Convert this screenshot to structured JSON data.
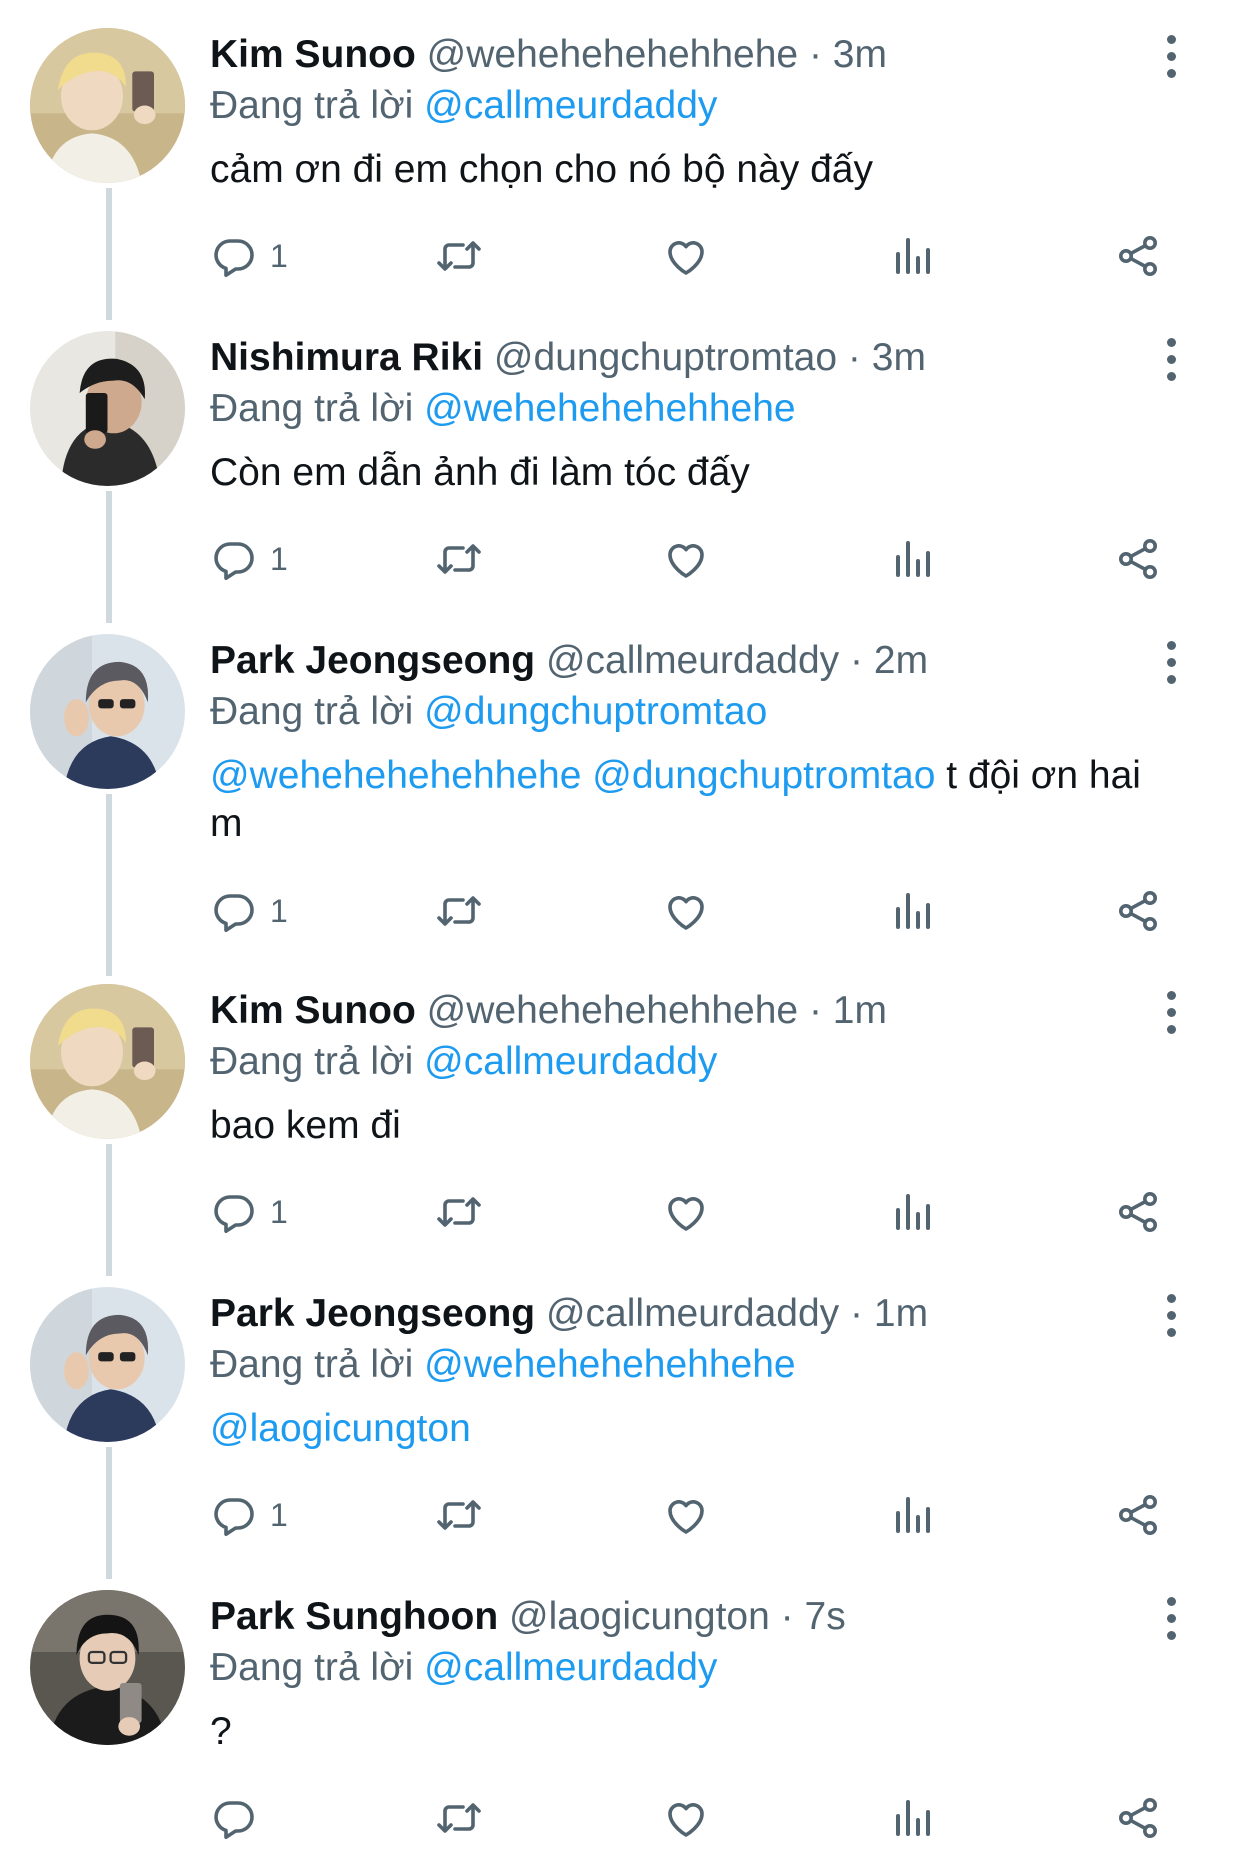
{
  "replying_prefix": "Đang trả lời",
  "tweets": [
    {
      "name": "Kim Sunoo",
      "handle": "@wehehehehehhehe",
      "separator": "·",
      "time": "3m",
      "replying_to": "@callmeurdaddy",
      "text": "cảm ơn đi em chọn cho nó bộ này đấy",
      "reply_count": "1",
      "avatar": "kim-sunoo-avatar"
    },
    {
      "name": "Nishimura Riki",
      "handle": "@dungchuptromtao",
      "separator": "·",
      "time": "3m",
      "replying_to": "@wehehehehehhehe",
      "text": "Còn em dẫn ảnh đi làm tóc đấy",
      "reply_count": "1",
      "avatar": "nishimura-riki-avatar"
    },
    {
      "name": "Park Jeongseong",
      "handle": "@callmeurdaddy",
      "separator": "·",
      "time": "2m",
      "replying_to": "@dungchuptromtao",
      "text_mention_1": "@wehehehehehhehe",
      "text_mention_2": "@dungchuptromtao",
      "text_tail": " t đội ơn hai m",
      "reply_count": "1",
      "avatar": "park-jeongseong-avatar"
    },
    {
      "name": "Kim Sunoo",
      "handle": "@wehehehehehhehe",
      "separator": "·",
      "time": "1m",
      "replying_to": "@callmeurdaddy",
      "text": "bao kem đi",
      "reply_count": "1",
      "avatar": "kim-sunoo-avatar"
    },
    {
      "name": "Park Jeongseong",
      "handle": "@callmeurdaddy",
      "separator": "·",
      "time": "1m",
      "replying_to": "@wehehehehehhehe",
      "text_mention_1": "@laogicungton",
      "reply_count": "1",
      "avatar": "park-jeongseong-avatar"
    },
    {
      "name": "Park Sunghoon",
      "handle": "@laogicungton",
      "separator": "·",
      "time": "7s",
      "replying_to": "@callmeurdaddy",
      "text": "?",
      "reply_count": "",
      "avatar": "park-sunghoon-avatar"
    }
  ],
  "colors": {
    "accent": "#1d9bf0",
    "secondary_text": "#536471",
    "primary_text": "#0f1419",
    "thread_line": "#cfd9de"
  },
  "icons": [
    "reply-icon",
    "retweet-icon",
    "like-icon",
    "views-icon",
    "share-icon",
    "more-icon"
  ]
}
